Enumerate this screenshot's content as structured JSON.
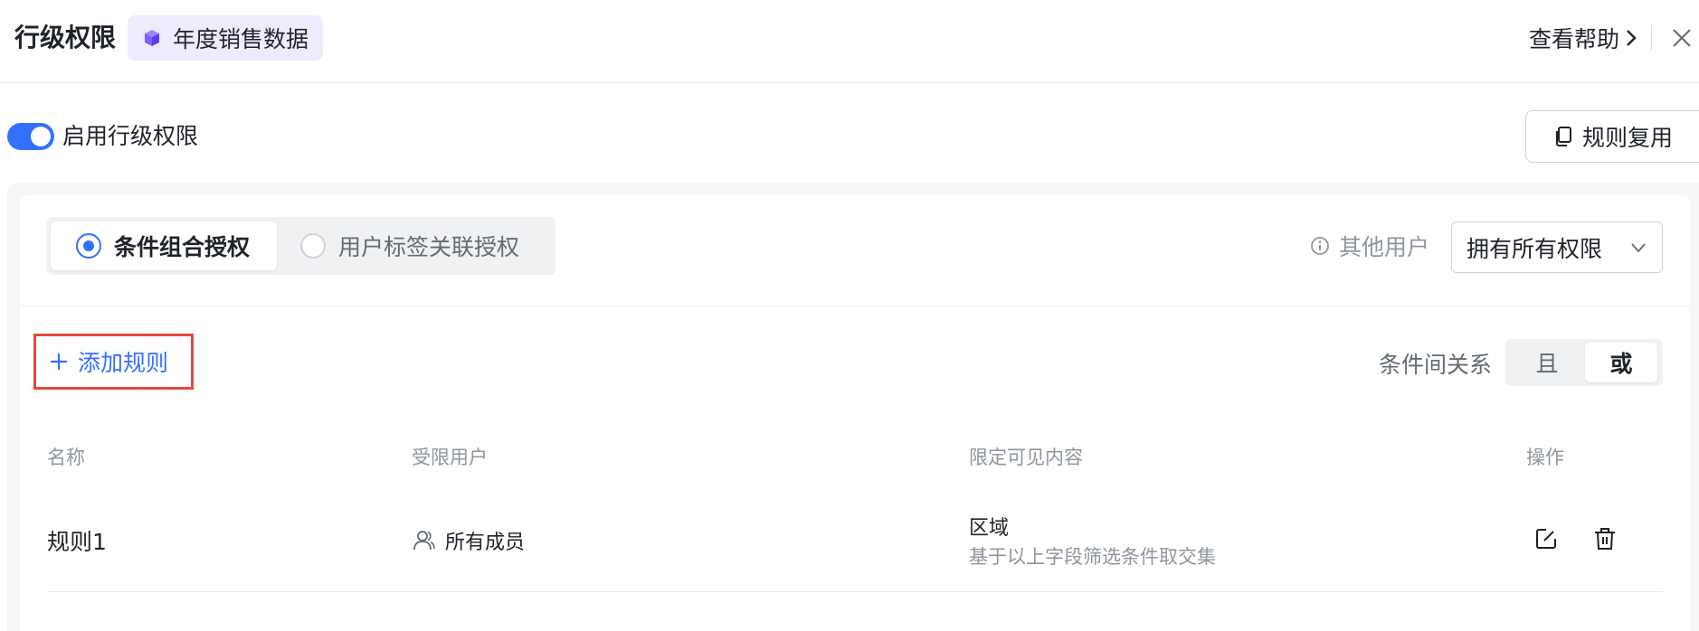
{
  "header": {
    "title": "行级权限",
    "dataset_name": "年度销售数据",
    "help_label": "查看帮助"
  },
  "enable": {
    "label": "启用行级权限",
    "enabled": true
  },
  "toolbar": {
    "reuse_label": "规则复用"
  },
  "auth_modes": [
    {
      "label": "条件组合授权",
      "selected": true
    },
    {
      "label": "用户标签关联授权",
      "selected": false
    }
  ],
  "other_users": {
    "label": "其他用户",
    "selected_value": "拥有所有权限"
  },
  "rules": {
    "add_label": "添加规则",
    "relation_label": "条件间关系",
    "relation_options": [
      "且",
      "或"
    ],
    "relation_selected": "或"
  },
  "table": {
    "columns": [
      "名称",
      "受限用户",
      "限定可见内容",
      "操作"
    ],
    "rows": [
      {
        "name": "规则1",
        "users": "所有成员",
        "content_field": "区域",
        "content_desc": "基于以上字段筛选条件取交集"
      }
    ]
  },
  "colors": {
    "accent": "#3370ff",
    "highlight_border": "#e5493f",
    "tag_bg": "#eeebfd",
    "cube_icon": "#7b61ff"
  },
  "icons": {
    "dataset": "cube-icon",
    "help": "chevron-right-icon",
    "close": "close-icon",
    "reuse": "copy-icon",
    "info": "info-icon",
    "select": "chevron-down-icon",
    "add": "plus-icon",
    "user": "user-icon",
    "edit": "edit-icon",
    "delete": "trash-icon"
  }
}
